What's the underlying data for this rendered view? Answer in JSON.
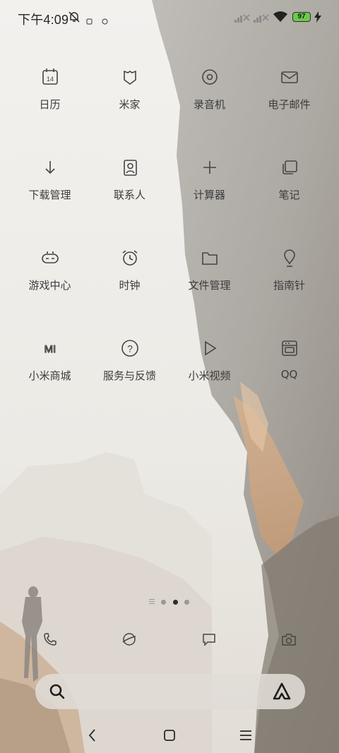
{
  "status_bar": {
    "time": "下午4:09",
    "battery_level": "97",
    "icons": [
      "bell-off-icon",
      "notification-icon",
      "notification-dot-icon",
      "signal-no-service-icon",
      "signal-no-service-icon",
      "wifi-icon",
      "battery-icon",
      "charging-bolt-icon"
    ]
  },
  "apps": [
    {
      "label": "日历",
      "icon": "calendar-icon",
      "icon_text": "14"
    },
    {
      "label": "米家",
      "icon": "mijia-icon"
    },
    {
      "label": "录音机",
      "icon": "recorder-icon"
    },
    {
      "label": "电子邮件",
      "icon": "email-icon"
    },
    {
      "label": "下载管理",
      "icon": "download-icon"
    },
    {
      "label": "联系人",
      "icon": "contacts-icon"
    },
    {
      "label": "计算器",
      "icon": "calculator-icon"
    },
    {
      "label": "笔记",
      "icon": "notes-icon"
    },
    {
      "label": "游戏中心",
      "icon": "gamepad-icon"
    },
    {
      "label": "时钟",
      "icon": "clock-icon"
    },
    {
      "label": "文件管理",
      "icon": "folder-icon"
    },
    {
      "label": "指南针",
      "icon": "compass-icon"
    },
    {
      "label": "小米商城",
      "icon": "mi-store-icon",
      "icon_text": "MI"
    },
    {
      "label": "服务与反馈",
      "icon": "help-icon",
      "icon_text": "?"
    },
    {
      "label": "小米视频",
      "icon": "video-play-icon"
    },
    {
      "label": "QQ",
      "icon": "qq-icon"
    }
  ],
  "page_indicator": {
    "pages": 3,
    "current": 2
  },
  "dock": [
    {
      "icon": "phone-icon"
    },
    {
      "icon": "browser-icon"
    },
    {
      "icon": "messages-icon"
    },
    {
      "icon": "camera-icon"
    }
  ],
  "search": {
    "icon": "search-icon",
    "assistant_icon": "assistant-icon"
  },
  "nav": {
    "back": "back-icon",
    "home": "home-icon",
    "recents": "menu-icon"
  },
  "colors": {
    "text": "#3c3c3c",
    "icon_stroke": "#454545",
    "battery_fill": "#6cc94a"
  }
}
